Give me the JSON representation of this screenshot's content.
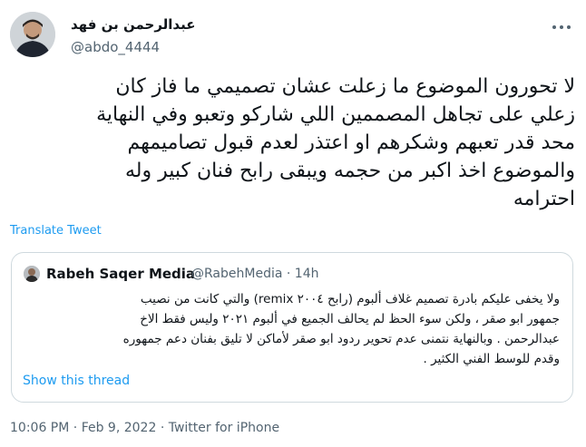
{
  "tweet": {
    "author_name": "عبدالرحمن بن فهد",
    "author_handle": "@abdo_4444",
    "text_lines": [
      "لا تحورون الموضوع ما زعلت عشان تصميمي ما فاز كان",
      "زعلي على تجاهل المصممين اللي شاركو وتعبو وفي النهاية",
      "محد قدر تعبهم وشكرهم او اعتذر لعدم قبول تصاميمهم",
      "والموضوع اخذ اكبر من حجمه ويبقى رابح فنان كبير وله",
      "احترامه"
    ],
    "translate_label": "Translate Tweet",
    "more_icon": "more-horizontal-icon",
    "timestamp": "10:06 PM",
    "date": "Feb 9, 2022",
    "source": "Twitter for iPhone",
    "separator": "·"
  },
  "quote": {
    "author_name": "Rabeh Saqer Media",
    "author_handle": "@RabehMedia",
    "time_ago": "14h",
    "separator": "·",
    "text_lines": [
      "ولا يخفى عليكم بادرة تصميم غلاف ألبوم (رابح ٢٠٠٤ remix) والتي كانت من نصيب",
      "جمهور ابو صقر ، ولكن سوء الحظ لم يحالف الجميع في ألبوم ٢٠٢١ وليس فقط الاخ",
      "عبدالرحمن . وبالنهاية نتمنى عدم تحوير ردود ابو صقر لأماكن لا تليق بفنان دعم جمهوره",
      "وقدم للوسط الفني الكثير ."
    ],
    "show_thread_label": "Show this thread"
  },
  "colors": {
    "link": "#1d9bf0",
    "secondary_text": "#536471",
    "border": "#cfd9de"
  }
}
